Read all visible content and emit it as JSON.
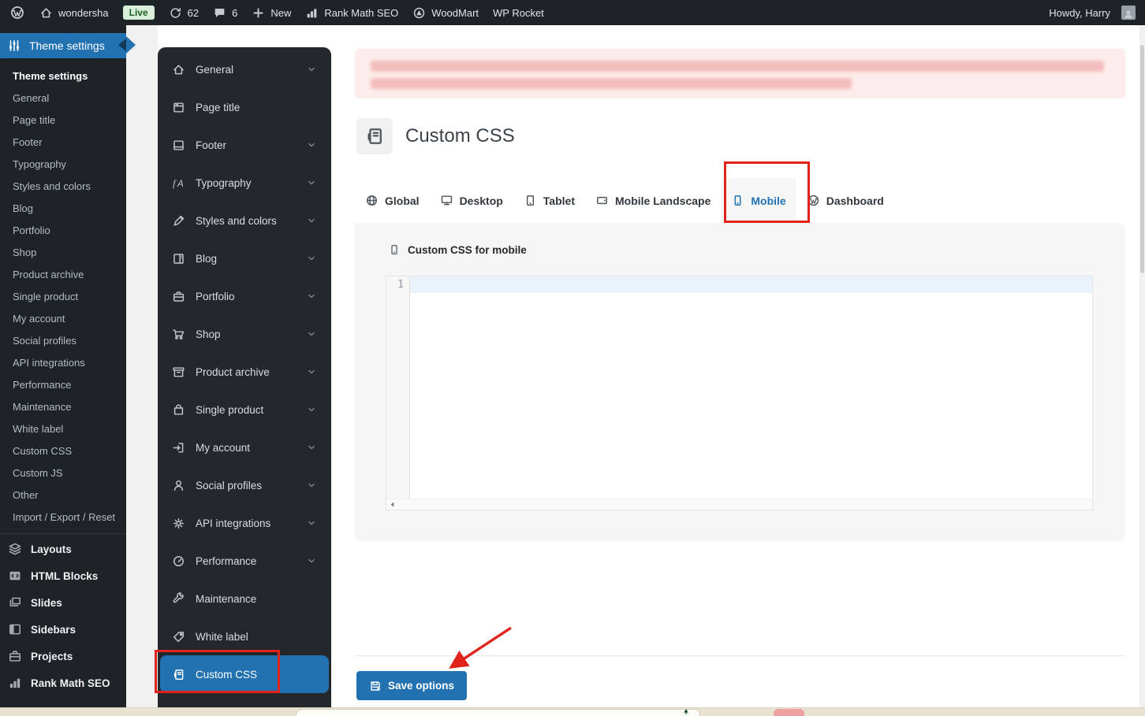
{
  "admin_bar": {
    "site_name": "wondersha",
    "live_badge": "Live",
    "updates_count": "62",
    "comments_count": "6",
    "new_label": "New",
    "rank_math_label": "Rank Math SEO",
    "woodmart_label": "WoodMart",
    "wp_rocket_label": "WP Rocket",
    "howdy": "Howdy, Harry"
  },
  "sidebar": {
    "header": "Theme settings",
    "submenu": [
      {
        "label": "Theme settings",
        "active": true
      },
      {
        "label": "General"
      },
      {
        "label": "Page title"
      },
      {
        "label": "Footer"
      },
      {
        "label": "Typography"
      },
      {
        "label": "Styles and colors"
      },
      {
        "label": "Blog"
      },
      {
        "label": "Portfolio"
      },
      {
        "label": "Shop"
      },
      {
        "label": "Product archive"
      },
      {
        "label": "Single product"
      },
      {
        "label": "My account"
      },
      {
        "label": "Social profiles"
      },
      {
        "label": "API integrations"
      },
      {
        "label": "Performance"
      },
      {
        "label": "Maintenance"
      },
      {
        "label": "White label"
      },
      {
        "label": "Custom CSS"
      },
      {
        "label": "Custom JS"
      },
      {
        "label": "Other"
      },
      {
        "label": "Import / Export / Reset"
      }
    ],
    "tools": [
      {
        "label": "Layouts",
        "icon": "layers"
      },
      {
        "label": "HTML Blocks",
        "icon": "code"
      },
      {
        "label": "Slides",
        "icon": "slides"
      },
      {
        "label": "Sidebars",
        "icon": "sidebars"
      },
      {
        "label": "Projects",
        "icon": "briefcase"
      },
      {
        "label": "Rank Math SEO",
        "icon": "chart-bars"
      }
    ]
  },
  "settings_nav": {
    "items": [
      {
        "label": "General",
        "icon": "home",
        "chevron": true
      },
      {
        "label": "Page title",
        "icon": "page",
        "chevron": false
      },
      {
        "label": "Footer",
        "icon": "footer",
        "chevron": true
      },
      {
        "label": "Typography",
        "icon": "typography",
        "chevron": true
      },
      {
        "label": "Styles and colors",
        "icon": "brush",
        "chevron": true
      },
      {
        "label": "Blog",
        "icon": "blog",
        "chevron": true
      },
      {
        "label": "Portfolio",
        "icon": "briefcase",
        "chevron": true
      },
      {
        "label": "Shop",
        "icon": "cart",
        "chevron": true
      },
      {
        "label": "Product archive",
        "icon": "archive",
        "chevron": true
      },
      {
        "label": "Single product",
        "icon": "bag",
        "chevron": true
      },
      {
        "label": "My account",
        "icon": "login",
        "chevron": true
      },
      {
        "label": "Social profiles",
        "icon": "person",
        "chevron": true
      },
      {
        "label": "API integrations",
        "icon": "gear",
        "chevron": true
      },
      {
        "label": "Performance",
        "icon": "speedometer",
        "chevron": true
      },
      {
        "label": "Maintenance",
        "icon": "wrench",
        "chevron": false
      },
      {
        "label": "White label",
        "icon": "tag",
        "chevron": false
      },
      {
        "label": "Custom CSS",
        "icon": "css-doc",
        "chevron": false,
        "active": true
      }
    ]
  },
  "main": {
    "page_title": "Custom CSS",
    "tabs": [
      {
        "label": "Global",
        "icon": "globe"
      },
      {
        "label": "Desktop",
        "icon": "desktop"
      },
      {
        "label": "Tablet",
        "icon": "tablet"
      },
      {
        "label": "Mobile Landscape",
        "icon": "mobile-landscape"
      },
      {
        "label": "Mobile",
        "icon": "mobile",
        "active": true
      },
      {
        "label": "Dashboard",
        "icon": "wordpress"
      }
    ],
    "editor": {
      "label": "Custom CSS for mobile",
      "line_number": "1",
      "content": ""
    },
    "save_button": "Save options"
  },
  "colors": {
    "accent_blue": "#2271b1",
    "annotation_red": "#e0241b",
    "admin_dark": "#1d2327",
    "panel_dark": "#23282d",
    "notice_pink_bg": "#fcedec",
    "live_badge_bg": "#d9efd9",
    "live_badge_text": "#1c611f",
    "editor_active_line": "#e9f2fb",
    "panel_gray": "#f6f6f7"
  }
}
